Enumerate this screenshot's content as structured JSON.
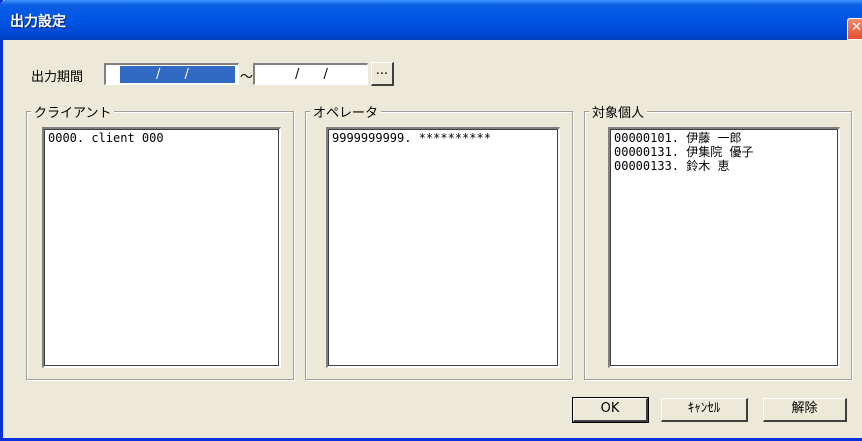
{
  "window": {
    "title": "出力設定",
    "close_glyph": "✕"
  },
  "period": {
    "label": "出力期間",
    "start_value": "/ /",
    "separator": "～",
    "end_value": "/ /",
    "picker_label": "..."
  },
  "groups": {
    "client": {
      "title": "クライアント",
      "items": [
        "0000. client 000"
      ]
    },
    "operator": {
      "title": "オペレータ",
      "items": [
        "9999999999. **********"
      ]
    },
    "target": {
      "title": "対象個人",
      "items": [
        "00000101. 伊藤 一郎",
        "00000131. 伊集院 優子",
        "00000133. 鈴木 恵"
      ]
    }
  },
  "buttons": {
    "ok": "OK",
    "cancel": "ｷｬﾝｾﾙ",
    "release": "解除"
  }
}
